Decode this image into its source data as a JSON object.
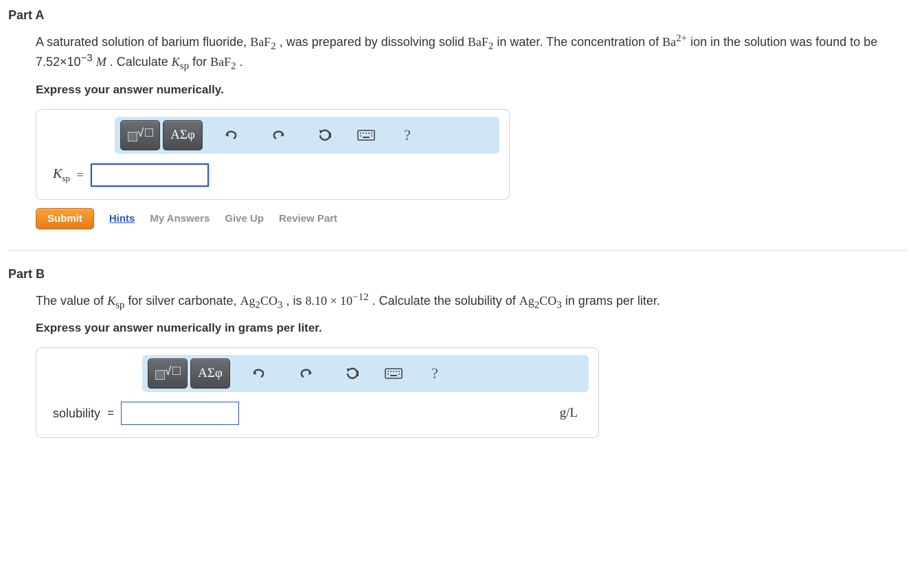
{
  "partA": {
    "title": "Part A",
    "prompt_segments": {
      "s1": "A saturated solution of barium fluoride, ",
      "f1": "BaF",
      "f1_sub": "2",
      "s2": " , was prepared by dissolving solid ",
      "f2": "BaF",
      "f2_sub": "2",
      "s3": " in water. The concentration of ",
      "f3": "Ba",
      "f3_sup": "2+",
      "s4": " ion in the solution was found to be 7.52×10",
      "exp": "−3",
      "s5": " ",
      "unitM": "M",
      "s6": " . Calculate ",
      "ksp": "K",
      "ksp_sub": "sp",
      "s7": " for ",
      "f4": "BaF",
      "f4_sub": "2",
      "s8": " ."
    },
    "instruction": "Express your answer numerically.",
    "var_label": "K",
    "var_sub": "sp",
    "equals": " = ",
    "input_value": ""
  },
  "partB": {
    "title": "Part B",
    "prompt_segments": {
      "s1": "The value of ",
      "ksp": "K",
      "ksp_sub": "sp",
      "s2": " for silver carbonate, ",
      "f1": "Ag",
      "f1_sub": "2",
      "f1b": "CO",
      "f1b_sub": "3",
      "s3": " , is ",
      "val": "8.10 × 10",
      "exp": "−12",
      "s4": " . Calculate the solubility of ",
      "f2": "Ag",
      "f2_sub": "2",
      "f2b": "CO",
      "f2b_sub": "3",
      "s5": " in grams per liter."
    },
    "instruction": "Express your answer numerically in grams per liter.",
    "var_label": "solubility",
    "equals": " = ",
    "input_value": "",
    "unit": "g/L"
  },
  "toolbar": {
    "greek": "ΑΣφ",
    "help": "?"
  },
  "actions": {
    "submit": "Submit",
    "hints": "Hints",
    "my_answers": "My Answers",
    "give_up": "Give Up",
    "review": "Review Part"
  }
}
